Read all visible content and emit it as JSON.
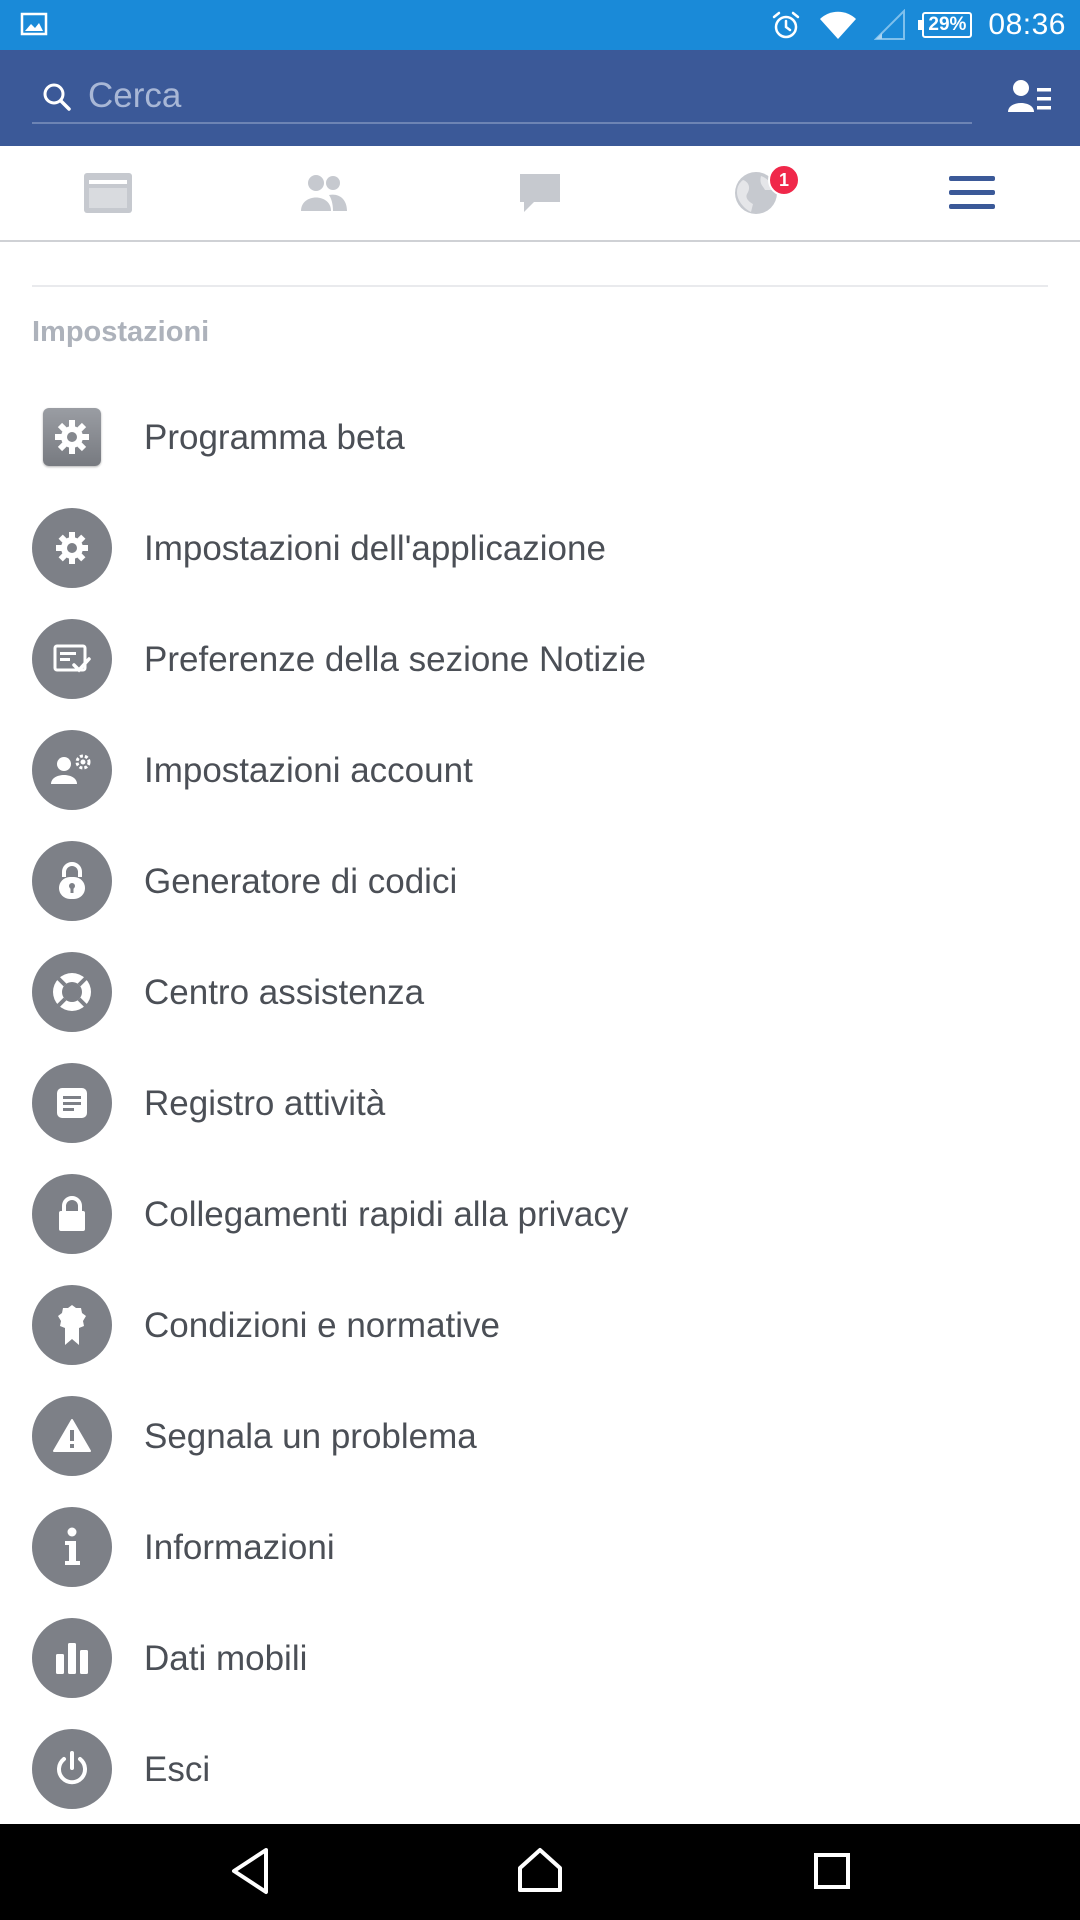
{
  "status_bar": {
    "battery_text": "29%",
    "time": "08:36"
  },
  "search": {
    "placeholder": "Cerca"
  },
  "tabs": [
    {
      "name": "news-feed"
    },
    {
      "name": "friend-requests"
    },
    {
      "name": "messages"
    },
    {
      "name": "notifications",
      "badge": "1"
    },
    {
      "name": "menu",
      "active": true
    }
  ],
  "settings": {
    "section_title": "Impostazioni",
    "items": [
      {
        "label": "Programma beta",
        "icon": "gear-icon"
      },
      {
        "label": "Impostazioni dell'applicazione",
        "icon": "gear-icon"
      },
      {
        "label": "Preferenze della sezione Notizie",
        "icon": "feed-check-icon"
      },
      {
        "label": "Impostazioni account",
        "icon": "user-gear-icon"
      },
      {
        "label": "Generatore di codici",
        "icon": "code-lock-icon"
      },
      {
        "label": "Centro assistenza",
        "icon": "lifebuoy-icon"
      },
      {
        "label": "Registro attività",
        "icon": "document-icon"
      },
      {
        "label": "Collegamenti rapidi alla privacy",
        "icon": "lock-icon"
      },
      {
        "label": "Condizioni e normative",
        "icon": "ribbon-icon"
      },
      {
        "label": "Segnala un problema",
        "icon": "warning-icon"
      },
      {
        "label": "Informazioni",
        "icon": "info-icon"
      },
      {
        "label": "Dati mobili",
        "icon": "bar-chart-icon"
      },
      {
        "label": "Esci",
        "icon": "power-icon"
      }
    ]
  },
  "colors": {
    "status_bar": "#1a8ad8",
    "brand": "#3b5998",
    "icon_grey": "#7d8087",
    "badge_red": "#f0284a"
  }
}
